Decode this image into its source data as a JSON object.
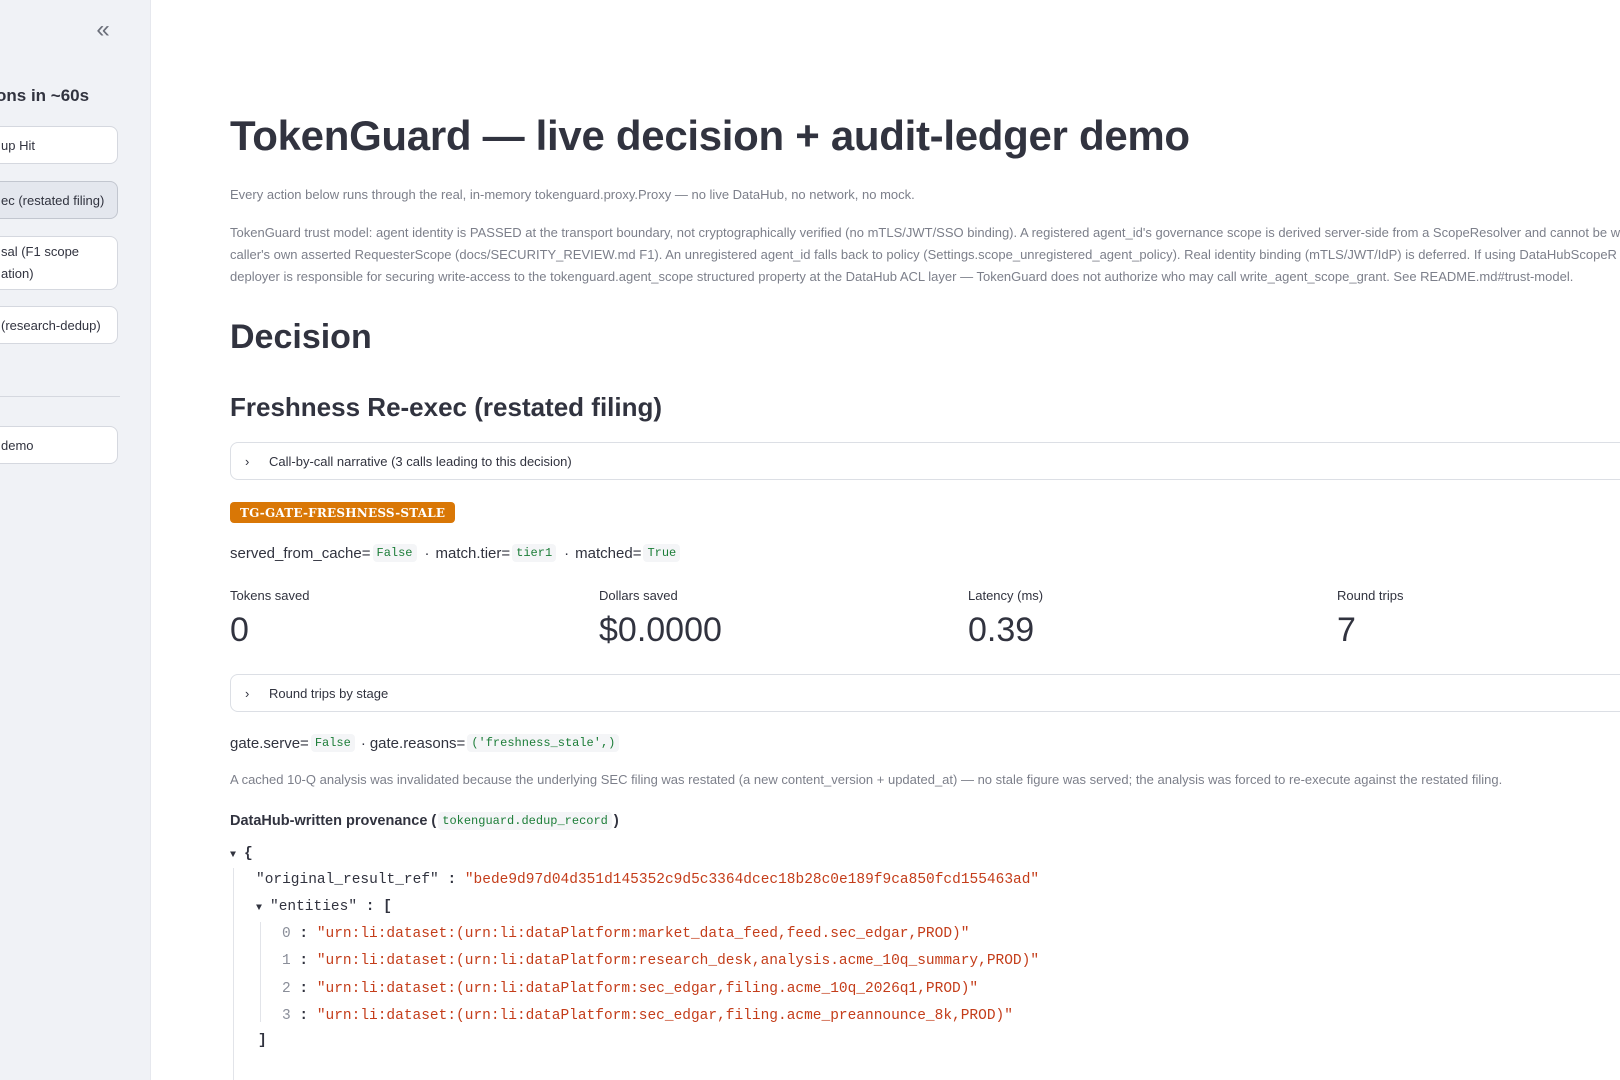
{
  "sidebar": {
    "heading": "ons in ~60s",
    "buttons": [
      {
        "label": "up Hit"
      },
      {
        "label": "ec (restated filing)"
      },
      {
        "label": "sal (F1 scope ation)"
      },
      {
        "label": " (research-dedup)"
      }
    ],
    "bottom_button": "demo"
  },
  "main": {
    "title": "TokenGuard — live decision + audit-ledger demo",
    "caption1": "Every action below runs through the real, in-memory tokenguard.proxy.Proxy — no live DataHub, no network, no mock.",
    "caption2": "TokenGuard trust model: agent identity is PASSED at the transport boundary, not cryptographically verified (no mTLS/JWT/SSO binding). A registered agent_id's governance scope is derived server-side from a ScopeResolver and cannot be w the caller's own asserted RequesterScope (docs/SECURITY_REVIEW.md F1). An unregistered agent_id falls back to policy (Settings.scope_unregistered_agent_policy). Real identity binding (mTLS/JWT/IdP) is deferred. If using DataHubScopeR deployer is responsible for securing write-access to the tokenguard.agent_scope structured property at the DataHub ACL layer — TokenGuard does not authorize who may call write_agent_scope_grant. See README.md#trust-model.",
    "section_title": "Decision",
    "scenario_title": "Freshness Re-exec (restated filing)",
    "expander_narrative": "Call-by-call narrative (3 calls leading to this decision)",
    "badge": "TG-GATE-FRESHNESS-STALE",
    "served_from_cache_label": "served_from_cache=",
    "served_from_cache_value": "False",
    "match_tier_label": "match.tier=",
    "match_tier_value": "tier1",
    "matched_label": "matched=",
    "matched_value": "True",
    "metrics": [
      {
        "label": "Tokens saved",
        "value": "0"
      },
      {
        "label": "Dollars saved",
        "value": "$0.0000"
      },
      {
        "label": "Latency (ms)",
        "value": "0.39"
      },
      {
        "label": "Round trips",
        "value": "7"
      }
    ],
    "expander_round_trips": "Round trips by stage",
    "gate_serve_label": "gate.serve=",
    "gate_serve_value": "False",
    "gate_reasons_label": "gate.reasons=",
    "gate_reasons_value": "('freshness_stale',)",
    "explanation": "A cached 10-Q analysis was invalidated because the underlying SEC filing was restated (a new content_version + updated_at) — no stale figure was served; the analysis was forced to re-execute against the restated filing.",
    "provenance_label": "DataHub-written provenance (",
    "provenance_code": "tokenguard.dedup_record",
    "provenance_close": ")"
  },
  "json_view": {
    "open_brace": "{",
    "original_result_ref_key": "\"original_result_ref\"",
    "original_result_ref_value": "\"bede9d97d04d351d145352c9d5c3364dcec18b28c0e189f9ca850fcd155463ad\"",
    "entities_key": "\"entities\"",
    "entities_open": "[",
    "entities": [
      {
        "index": "0",
        "value": "\"urn:li:dataset:(urn:li:dataPlatform:market_data_feed,feed.sec_edgar,PROD)\""
      },
      {
        "index": "1",
        "value": "\"urn:li:dataset:(urn:li:dataPlatform:research_desk,analysis.acme_10q_summary,PROD)\""
      },
      {
        "index": "2",
        "value": "\"urn:li:dataset:(urn:li:dataPlatform:sec_edgar,filing.acme_10q_2026q1,PROD)\""
      },
      {
        "index": "3",
        "value": "\"urn:li:dataset:(urn:li:dataPlatform:sec_edgar,filing.acme_preannounce_8k,PROD)\""
      }
    ],
    "entities_close": "]"
  },
  "icons": {
    "collapse": "double-chevron-left-icon",
    "expander": "chevron-right-icon",
    "json_toggle": "caret-down-icon"
  },
  "colors": {
    "badge": "#d97706",
    "code_text": "#1c7d38",
    "json_string": "#c43d1a",
    "sidebar_bg": "#f0f2f6"
  }
}
